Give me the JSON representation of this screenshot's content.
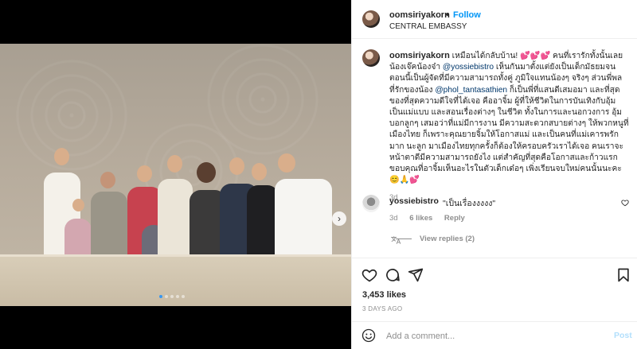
{
  "post": {
    "username": "oomsiriyakorn",
    "follow_label": "Follow",
    "separator": "•",
    "location": "CENTRAL EMBASSY",
    "caption": {
      "username": "oomsiriyakorn",
      "part1": "เหมือนได้กลับบ้าน!",
      "emoji1": "💕💕💕",
      "part2": " คนที่เรารักทั้งนั้นเลย น้องเจ๊คน้องจ๋า ",
      "mention1": "@yossiebistro",
      "part3": " เห็นกันมาตั้งแต่ยังเป็นเด็กมัธยมจนตอนนี้เป็นผู้จัดที่มีความสามารถทั้งคู่ ภูมิใจแทนน้องๆ จริงๆ ส่วนพี่พลที่รักของน้อง ",
      "mention2": "@phol_tantasathien",
      "part4": " ก็เป็นพี่ที่แสนดีเสมอมา และที่สุดของที่สุดความดีใจที่ได้เจอ คืออาจิ้ม ผู้ที่ให้ชีวิตในการบันเทิงกับอุ้ม เป็นแม่แบบ และสอนเรื่องต่างๆ ในชีวิต ทั้งในการและนอกวงการ อุ้มบอกลูกๆ เสมอว่าที่แม่มีการงาน มีความสะดวกสบายต่างๆ ให้พวกหนูที่เมืองไทย ก็เพราะคุณยายจิ้มให้โอกาสแม่ และเป็นคนที่แม่เคารพรักมาก นะลูก มาเมืองไทยทุกครั้งก็ต้องให้ครอบครัวเราได้เจอ คนเราจะหน้าตาดีมีความสามารถยังไง แต่สำคัญที่สุดคือโอกาสและก้าวแรก ขอบคุณที่อาจิ้มเห็นอะไรในตัวเด็กเด๋อๆ เพิ่งเรียนจบใหม่คนนั้นนะคะ",
      "emoji2": "😊🙏💕",
      "time": "3d"
    },
    "comment": {
      "username": "yossiebistro",
      "text": "\"เป็นเรื่องงงงง\"",
      "time": "3d",
      "likes": "6 likes",
      "reply": "Reply",
      "view_replies": "View replies (2)"
    },
    "likes_count": "3,453 likes",
    "date": "3 DAYS AGO",
    "add_comment_placeholder": "Add a comment...",
    "post_button": "Post"
  },
  "carousel": {
    "count": 5,
    "active_index": 0,
    "next_symbol": "›"
  },
  "colors": {
    "link": "#0095f6",
    "mention": "#00376b",
    "secondary": "#8e8e8e",
    "active_dot": "#3897f0"
  }
}
